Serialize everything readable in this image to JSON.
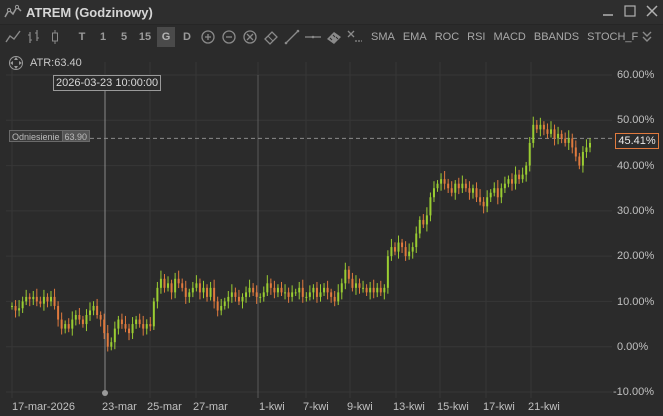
{
  "window": {
    "title": "ATREM (Godzinowy)"
  },
  "toolbar": {
    "chart_types": [
      "line-chart-icon",
      "bar-chart-icon",
      "candlestick-icon"
    ],
    "timeframes": [
      {
        "label": "T",
        "active": false
      },
      {
        "label": "1",
        "active": false
      },
      {
        "label": "5",
        "active": false
      },
      {
        "label": "15",
        "active": false
      },
      {
        "label": "G",
        "active": true
      },
      {
        "label": "D",
        "active": false
      }
    ],
    "tools": [
      "zoom-in-icon",
      "zoom-out-icon",
      "zoom-reset-icon",
      "eraser-icon",
      "trendline-icon",
      "horizontal-line-icon",
      "ruler-icon",
      "clear-drawings-icon"
    ],
    "indicators": [
      "SMA",
      "EMA",
      "ROC",
      "RSI",
      "MACD",
      "BBANDS",
      "STOCH_F"
    ]
  },
  "indicator_row": {
    "atr_label": "ATR:",
    "atr_value": "63.40"
  },
  "crosshair": {
    "date_label": "2026-03-23 10:00:00"
  },
  "reference": {
    "name": "Odniesienie",
    "value": "63.90"
  },
  "last_change": "45.41%",
  "colors": {
    "background": "#2b2b2b",
    "up_candle": "#9acd32",
    "down_candle": "#e07a3e",
    "grid": "#373737",
    "reference_line": "#8a8a8a",
    "crosshair": "#8a8a8a"
  },
  "chart_data": {
    "type": "candlestick",
    "y_axis": {
      "unit": "%",
      "ticks": [
        "60.00%",
        "50.00%",
        "40.00%",
        "30.00%",
        "20.00%",
        "10.00%",
        "0.00%",
        "-10.00%"
      ],
      "tick_values": [
        60,
        50,
        40,
        30,
        20,
        10,
        0,
        -10
      ],
      "range": [
        -10,
        60
      ]
    },
    "x_axis": {
      "ticks": [
        "17-mar-2026",
        "23-mar",
        "25-mar",
        "27-mar",
        "1-kwi",
        "7-kwi",
        "9-kwi",
        "13-kwi",
        "15-kwi",
        "17-kwi",
        "21-kwi"
      ]
    },
    "reference_value_pct": 46,
    "crosshair_date": "23-mar",
    "series": [
      {
        "values_pct": [
          9,
          8,
          8.5,
          10,
          11,
          10.5,
          11,
          10,
          9.5,
          11,
          10,
          11,
          9,
          6,
          4,
          5,
          4,
          6,
          7,
          6,
          5,
          7,
          8,
          9,
          7,
          6,
          3,
          0,
          1,
          4,
          6,
          5,
          4,
          3,
          5,
          6,
          5,
          4,
          5,
          4.5,
          10,
          13,
          15,
          13,
          14,
          12,
          15,
          14,
          13,
          11,
          12,
          13,
          14,
          12,
          13,
          11,
          13,
          10,
          8,
          9,
          10,
          11,
          12,
          11,
          10,
          11,
          12,
          13,
          12,
          11,
          11,
          12,
          14,
          13,
          12,
          13,
          12,
          12,
          11,
          12,
          12,
          13,
          11,
          11,
          12,
          13,
          11,
          12,
          13,
          12,
          11,
          10,
          12,
          14,
          17,
          15,
          13,
          14,
          13,
          13,
          12,
          13,
          12,
          13,
          12,
          13,
          20,
          22,
          21,
          23,
          22,
          20,
          21,
          22,
          25,
          28,
          27,
          29,
          33,
          35,
          36,
          37,
          36,
          35,
          34,
          36,
          35,
          36,
          35,
          34,
          35,
          33,
          32,
          31,
          33,
          34,
          35,
          33,
          35,
          36,
          37,
          36,
          38,
          37,
          38,
          40,
          45,
          49,
          48,
          49,
          48,
          47,
          48,
          46,
          47,
          46,
          45,
          46,
          44,
          42,
          40,
          43,
          44,
          45
        ]
      }
    ]
  }
}
